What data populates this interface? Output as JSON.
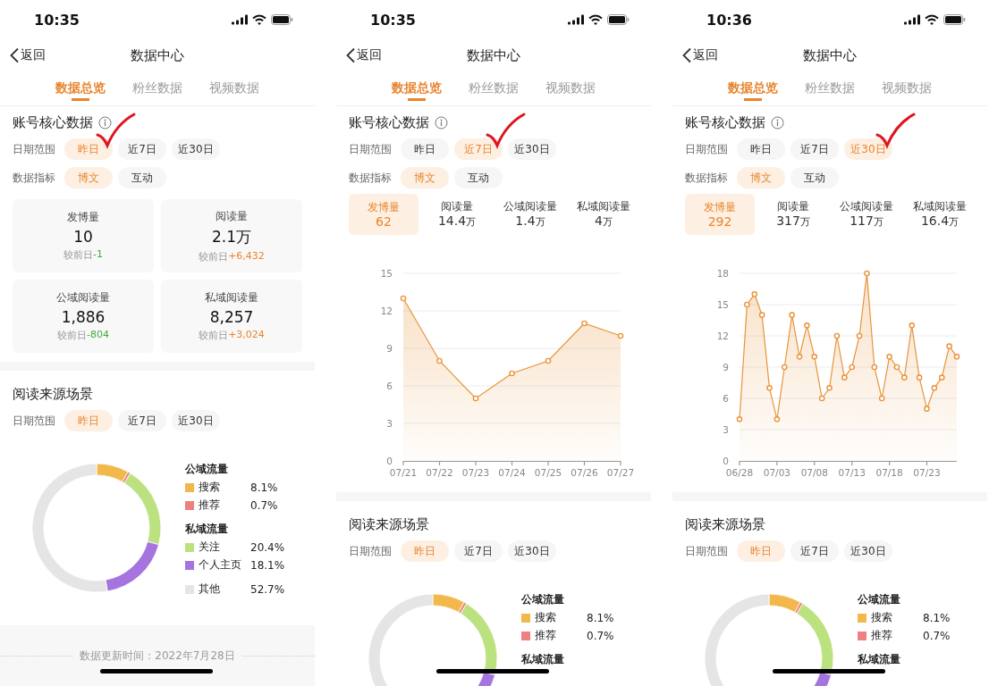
{
  "phones": [
    {
      "status_bar": {
        "time": "10:35"
      },
      "nav": {
        "back": "返回",
        "title": "数据中心"
      },
      "tabs": [
        {
          "label": "数据总览",
          "selected": true
        },
        {
          "label": "粉丝数据",
          "selected": false
        },
        {
          "label": "视频数据",
          "selected": false
        }
      ],
      "core": {
        "title": "账号核心数据",
        "annotation": {
          "kind": "checkmark"
        },
        "filters": [
          {
            "label": "日期范围",
            "options": [
              {
                "label": "昨日",
                "selected": true
              },
              {
                "label": "近7日",
                "selected": false
              },
              {
                "label": "近30日",
                "selected": false
              }
            ]
          },
          {
            "label": "数据指标",
            "options": [
              {
                "label": "博文",
                "selected": true
              },
              {
                "label": "互动",
                "selected": false
              }
            ]
          }
        ],
        "metrics": {
          "kind": "cards",
          "items": [
            {
              "label": "发博量",
              "value": "10",
              "compare": "较前日",
              "delta": "-1",
              "color": "#3faa3f"
            },
            {
              "label": "阅读量",
              "value": "2.1万",
              "compare": "较前日",
              "delta": "+6,432",
              "color": "#e8852e"
            },
            {
              "label": "公域阅读量",
              "value": "1,886",
              "compare": "较前日",
              "delta": "-804",
              "color": "#3faa3f"
            },
            {
              "label": "私域阅读量",
              "value": "8,257",
              "compare": "较前日",
              "delta": "+3,024",
              "color": "#e8852e"
            }
          ]
        }
      },
      "source": {
        "title": "阅读来源场景",
        "filter": {
          "label": "日期范围",
          "options": [
            {
              "label": "昨日",
              "selected": true
            },
            {
              "label": "近7日",
              "selected": false
            },
            {
              "label": "近30日",
              "selected": false
            }
          ]
        },
        "chart_data": {
          "type": "donut",
          "values": [
            8.1,
            0.7,
            20.4,
            18.1,
            52.7
          ]
        },
        "legend": [
          {
            "heading": "公域流量",
            "items": [
              {
                "label": "搜索",
                "value": "8.1%",
                "color": "#f2b84b"
              },
              {
                "label": "推荐",
                "value": "0.7%",
                "color": "#ee8080"
              }
            ]
          },
          {
            "heading": "私域流量",
            "items": [
              {
                "label": "关注",
                "value": "20.4%",
                "color": "#bbe27e"
              },
              {
                "label": "个人主页",
                "value": "18.1%",
                "color": "#a674de"
              }
            ]
          },
          {
            "items": [
              {
                "label": "其他",
                "value": "52.7%",
                "color": "#e5e5e5"
              }
            ]
          }
        ]
      },
      "footer": {
        "text": "数据更新时间：2022年7月28日"
      }
    },
    {
      "status_bar": {
        "time": "10:35"
      },
      "nav": {
        "back": "返回",
        "title": "数据中心"
      },
      "tabs": [
        {
          "label": "数据总览",
          "selected": true
        },
        {
          "label": "粉丝数据",
          "selected": false
        },
        {
          "label": "视频数据",
          "selected": false
        }
      ],
      "core": {
        "title": "账号核心数据",
        "annotation": {
          "kind": "checkmark"
        },
        "filters": [
          {
            "label": "日期范围",
            "options": [
              {
                "label": "昨日",
                "selected": false
              },
              {
                "label": "近7日",
                "selected": true
              },
              {
                "label": "近30日",
                "selected": false
              }
            ]
          },
          {
            "label": "数据指标",
            "options": [
              {
                "label": "博文",
                "selected": true
              },
              {
                "label": "互动",
                "selected": false
              }
            ]
          }
        ],
        "metrics": {
          "kind": "tabs",
          "items": [
            {
              "label": "发博量",
              "value": "62",
              "selected": true
            },
            {
              "label": "阅读量",
              "value": "14.4",
              "unit": "万",
              "selected": false
            },
            {
              "label": "公域阅读量",
              "value": "1.4",
              "unit": "万",
              "selected": false
            },
            {
              "label": "私域阅读量",
              "value": "4",
              "unit": "万",
              "selected": false
            }
          ]
        },
        "chart_data": {
          "type": "area",
          "categories": [
            "07/21",
            "07/22",
            "07/23",
            "07/24",
            "07/25",
            "07/26",
            "07/27"
          ],
          "series": [
            {
              "color": "#e8943a",
              "values": [
                13,
                8,
                5,
                7,
                8,
                11,
                10
              ]
            }
          ],
          "ylim": [
            0,
            15
          ],
          "yticks": [
            0,
            3,
            6,
            9,
            12,
            15
          ],
          "grid": true
        }
      },
      "source": {
        "title": "阅读来源场景",
        "filter": {
          "label": "日期范围",
          "options": [
            {
              "label": "昨日",
              "selected": true
            },
            {
              "label": "近7日",
              "selected": false
            },
            {
              "label": "近30日",
              "selected": false
            }
          ]
        },
        "chart_data": {
          "type": "donut",
          "values": [
            8.1,
            0.7,
            20.4,
            18.1,
            52.7
          ]
        },
        "legend": [
          {
            "heading": "公域流量",
            "items": [
              {
                "label": "搜索",
                "value": "8.1%",
                "color": "#f2b84b"
              },
              {
                "label": "推荐",
                "value": "0.7%",
                "color": "#ee8080"
              }
            ]
          },
          {
            "heading": "私域流量"
          }
        ]
      }
    },
    {
      "status_bar": {
        "time": "10:36"
      },
      "nav": {
        "back": "返回",
        "title": "数据中心"
      },
      "tabs": [
        {
          "label": "数据总览",
          "selected": true
        },
        {
          "label": "粉丝数据",
          "selected": false
        },
        {
          "label": "视频数据",
          "selected": false
        }
      ],
      "core": {
        "title": "账号核心数据",
        "annotation": {
          "kind": "checkmark"
        },
        "filters": [
          {
            "label": "日期范围",
            "options": [
              {
                "label": "昨日",
                "selected": false
              },
              {
                "label": "近7日",
                "selected": false
              },
              {
                "label": "近30日",
                "selected": true
              }
            ]
          },
          {
            "label": "数据指标",
            "options": [
              {
                "label": "博文",
                "selected": true
              },
              {
                "label": "互动",
                "selected": false
              }
            ]
          }
        ],
        "metrics": {
          "kind": "tabs",
          "items": [
            {
              "label": "发博量",
              "value": "292",
              "selected": true
            },
            {
              "label": "阅读量",
              "value": "317",
              "unit": "万",
              "selected": false
            },
            {
              "label": "公域阅读量",
              "value": "117",
              "unit": "万",
              "selected": false
            },
            {
              "label": "私域阅读量",
              "value": "16.4",
              "unit": "万",
              "selected": false
            }
          ]
        },
        "chart_data": {
          "type": "area",
          "categories": [
            "06/28",
            null,
            null,
            null,
            null,
            "07/03",
            null,
            null,
            null,
            null,
            "07/08",
            null,
            null,
            null,
            null,
            "07/13",
            null,
            null,
            null,
            null,
            "07/18",
            null,
            null,
            null,
            null,
            "07/23",
            null,
            null,
            null,
            null
          ],
          "series": [
            {
              "color": "#e8943a",
              "values": [
                4,
                15,
                16,
                14,
                7,
                4,
                9,
                14,
                10,
                13,
                10,
                6,
                7,
                12,
                8,
                9,
                12,
                18,
                9,
                6,
                10,
                9,
                8,
                13,
                8,
                5,
                7,
                8,
                11,
                10
              ]
            }
          ],
          "ylim": [
            0,
            18
          ],
          "yticks": [
            0,
            3,
            6,
            9,
            12,
            15,
            18
          ],
          "grid": true
        }
      },
      "source": {
        "title": "阅读来源场景",
        "filter": {
          "label": "日期范围",
          "options": [
            {
              "label": "昨日",
              "selected": true
            },
            {
              "label": "近7日",
              "selected": false
            },
            {
              "label": "近30日",
              "selected": false
            }
          ]
        },
        "chart_data": {
          "type": "donut",
          "values": [
            8.1,
            0.7,
            20.4,
            18.1,
            52.7
          ]
        },
        "legend": [
          {
            "heading": "公域流量",
            "items": [
              {
                "label": "搜索",
                "value": "8.1%",
                "color": "#f2b84b"
              },
              {
                "label": "推荐",
                "value": "0.7%",
                "color": "#ee8080"
              }
            ]
          },
          {
            "heading": "私域流量"
          }
        ]
      }
    }
  ]
}
